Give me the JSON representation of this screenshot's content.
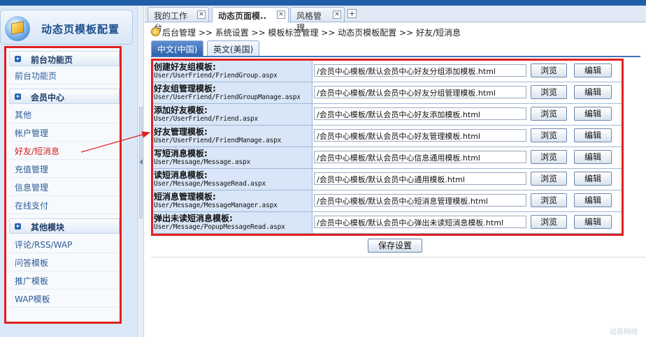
{
  "sidebar": {
    "title": "动态页模板配置",
    "sections": [
      {
        "label": "前台功能页",
        "items": [
          "前台功能页"
        ]
      },
      {
        "label": "会员中心",
        "items": [
          "其他",
          "帐户管理",
          "好友/短消息",
          "充值管理",
          "信息管理",
          "在线支付"
        ]
      },
      {
        "label": "其他模块",
        "items": [
          "评论/RSS/WAP",
          "问答模板",
          "推广模板",
          "WAP模板"
        ]
      }
    ]
  },
  "tabs": [
    {
      "label": "我的工作台"
    },
    {
      "label": "动态页面模.."
    },
    {
      "label": "风格管理"
    }
  ],
  "breadcrumb": "后台管理 >> 系统设置 >> 模板标签管理 >> 动态页模板配置 >> 好友/短消息",
  "lang_tabs": [
    "中文(中国)",
    "英文(美国)"
  ],
  "rows": [
    {
      "title": "创建好友组模板:",
      "path": "User/UserFriend/FriendGroup.aspx",
      "value": "/会员中心模板/默认会员中心好友分组添加模板.html"
    },
    {
      "title": "好友组管理模板:",
      "path": "User/UserFriend/FriendGroupManage.aspx",
      "value": "/会员中心模板/默认会员中心好友分组管理模板.html"
    },
    {
      "title": "添加好友模板:",
      "path": "User/UserFriend/Friend.aspx",
      "value": "/会员中心模板/默认会员中心好友添加模板.html"
    },
    {
      "title": "好友管理模板:",
      "path": "User/UserFriend/FriendManage.aspx",
      "value": "/会员中心模板/默认会员中心好友管理模板.html"
    },
    {
      "title": "写短消息模板:",
      "path": "User/Message/Message.aspx",
      "value": "/会员中心模板/默认会员中心信息通用模板.html"
    },
    {
      "title": "读短消息模板:",
      "path": "User/Message/MessageRead.aspx",
      "value": "/会员中心模板/默认会员中心通用模板.html"
    },
    {
      "title": "短消息管理模板:",
      "path": "User/Message/MessageManager.aspx",
      "value": "/会员中心模板/默认会员中心短消息管理模板.html"
    },
    {
      "title": "弹出未读短消息模板:",
      "path": "User/Message/PopupMessageRead.aspx",
      "value": "/会员中心模板/默认会员中心弹出未读短消息模板.html"
    }
  ],
  "buttons": {
    "browse": "浏览",
    "edit": "编辑",
    "save": "保存设置"
  },
  "watermark": "动易网络"
}
